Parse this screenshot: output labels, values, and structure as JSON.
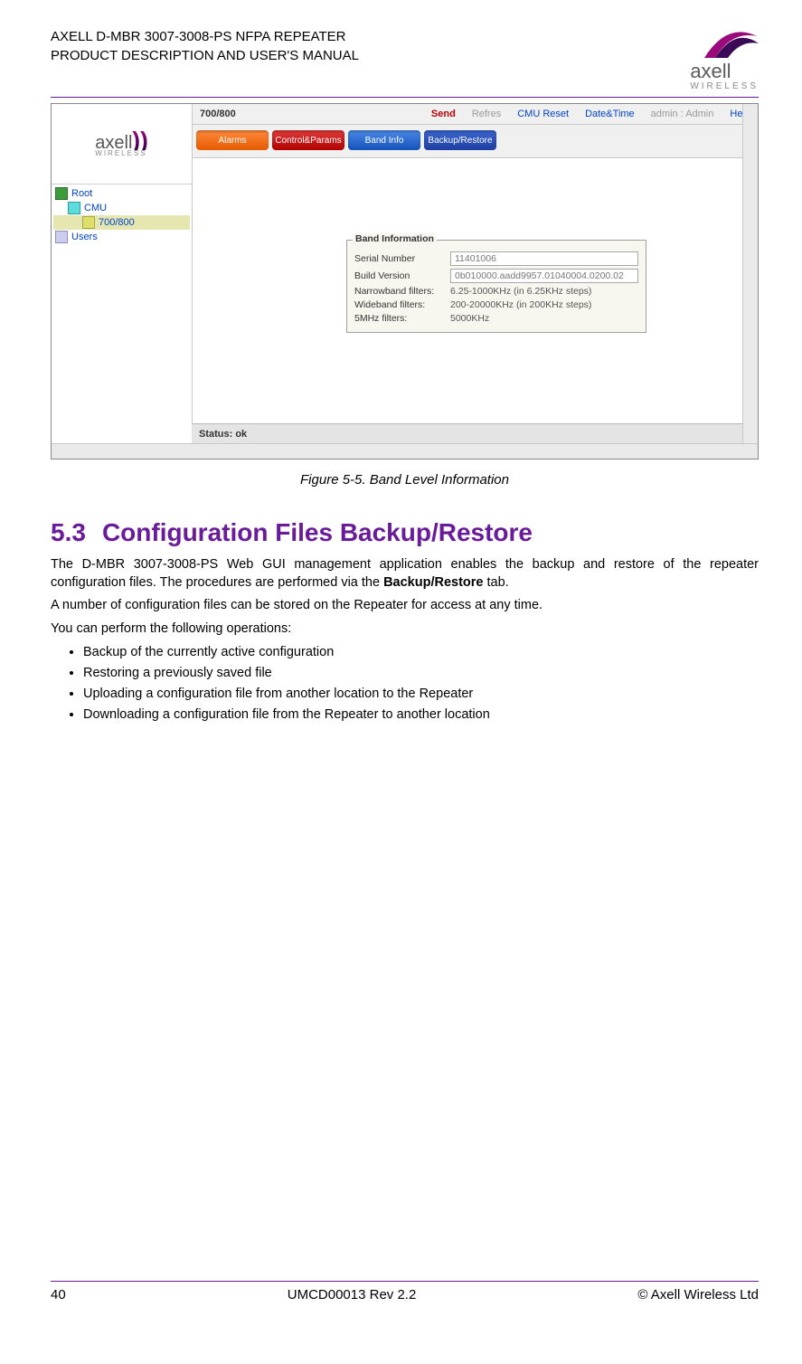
{
  "header": {
    "line1": "AXELL D-MBR 3007-3008-PS NFPA REPEATER",
    "line2": "PRODUCT DESCRIPTION AND USER'S MANUAL",
    "logo_text": "axell",
    "logo_sub": "WIRELESS"
  },
  "screenshot": {
    "toolbar": {
      "band_label": "700/800",
      "send": "Send",
      "refresh": "Refres",
      "cmu_reset": "CMU Reset",
      "date_time": "Date&Time",
      "admin": "admin : Admin",
      "help": "Help"
    },
    "tabs": {
      "alarms": "Alarms",
      "control_params": "Control&Params",
      "band_info": "Band Info",
      "backup_restore": "Backup/Restore"
    },
    "tree": {
      "root": "Root",
      "cmu": "CMU",
      "band": "700/800",
      "users": "Users"
    },
    "panel": {
      "legend": "Band Information",
      "serial_k": "Serial Number",
      "serial_v": "11401006",
      "build_k": "Build Version",
      "build_v": "0b010000.aadd9957.01040004.0200.02",
      "nb_k": "Narrowband filters:",
      "nb_v": "6.25-1000KHz (in 6.25KHz steps)",
      "wb_k": "Wideband filters:",
      "wb_v": "200-20000KHz (in 200KHz steps)",
      "f5_k": "5MHz filters:",
      "f5_v": "5000KHz"
    },
    "status": "Status: ok"
  },
  "figure_caption": "Figure 5-5. Band Level Information",
  "section": {
    "number": "5.3",
    "title": "Configuration Files Backup/Restore"
  },
  "para1_a": "The D-MBR 3007-3008-PS Web GUI management application enables the backup and restore of the repeater configuration files. The procedures are performed via the ",
  "para1_b": "Backup/Restore",
  "para1_c": " tab.",
  "para2": "A number of configuration files can be stored on the Repeater for access at any time.",
  "para3": "You can perform the following operations:",
  "bullets": [
    "Backup of the currently active configuration",
    "Restoring a previously saved file",
    "Uploading a configuration file from another location to the Repeater",
    "Downloading a configuration file from the Repeater to another location"
  ],
  "footer": {
    "page": "40",
    "doc": "UMCD00013 Rev 2.2",
    "copyright": "© Axell Wireless Ltd"
  }
}
